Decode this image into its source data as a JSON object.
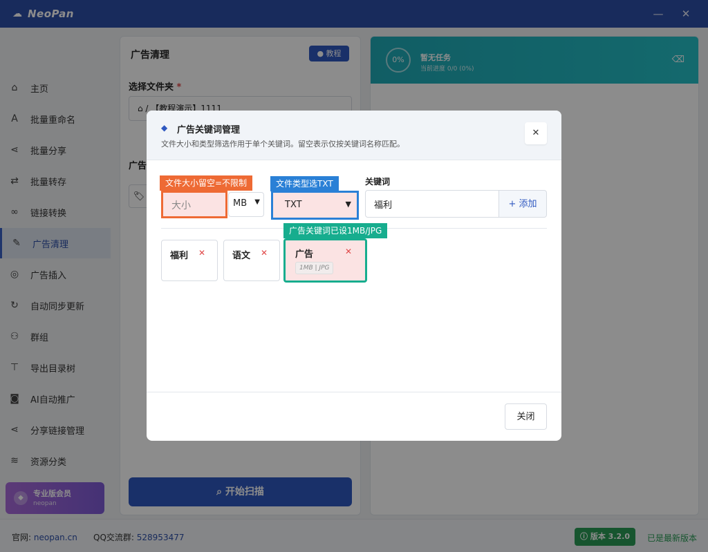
{
  "app": {
    "name": "NeoPan",
    "minimize": "—",
    "close": "✕"
  },
  "sidebar": {
    "items": [
      {
        "label": "主页",
        "icon": "home-icon",
        "glyph": "⌂"
      },
      {
        "label": "批量重命名",
        "icon": "text-icon",
        "glyph": "A"
      },
      {
        "label": "批量分享",
        "icon": "share-icon",
        "glyph": "⋖"
      },
      {
        "label": "批量转存",
        "icon": "transfer-icon",
        "glyph": "⇄"
      },
      {
        "label": "链接转换",
        "icon": "link-icon",
        "glyph": "∞"
      },
      {
        "label": "广告清理",
        "icon": "brush-icon",
        "glyph": "✎"
      },
      {
        "label": "广告插入",
        "icon": "target-icon",
        "glyph": "◎"
      },
      {
        "label": "自动同步更新",
        "icon": "sync-icon",
        "glyph": "↻"
      },
      {
        "label": "群组",
        "icon": "users-icon",
        "glyph": "⚇"
      },
      {
        "label": "导出目录树",
        "icon": "tree-icon",
        "glyph": "⊤"
      },
      {
        "label": "AI自动推广",
        "icon": "robot-icon",
        "glyph": "◙"
      },
      {
        "label": "分享链接管理",
        "icon": "share-icon",
        "glyph": "⋖"
      },
      {
        "label": "资源分类",
        "icon": "layers-icon",
        "glyph": "≋"
      }
    ],
    "vip": {
      "title": "专业版会员",
      "sub": "neopan"
    }
  },
  "left_panel": {
    "title": "广告清理",
    "tutorial": "教程",
    "folder_label": "选择文件夹",
    "required_mark": "*",
    "path": "⌂ / 【教程演示】1111",
    "ad_label": "广告",
    "scan": "开始扫描"
  },
  "right_panel": {
    "progress": "0%",
    "task_title": "暂无任务",
    "task_sub": "当前进度 0/0 (0%)"
  },
  "modal": {
    "title": "广告关键词管理",
    "desc": "文件大小和类型筛选作用于单个关键词。留空表示仅按关键词名称匹配。",
    "annotations": {
      "size": "文件大小留空=不限制",
      "type": "文件类型选TXT",
      "keyword": "广告关键词已设1MB/JPG"
    },
    "size_placeholder": "大小",
    "unit": "MB",
    "type_value": "TXT",
    "keyword_label": "关键词",
    "keyword_value": "福利",
    "add": "+ 添加",
    "keywords": [
      {
        "name": "福利",
        "meta": ""
      },
      {
        "name": "语文",
        "meta": ""
      },
      {
        "name": "广告",
        "meta": "1MB | JPG"
      }
    ],
    "close": "关闭"
  },
  "footer": {
    "site_label": "官网:",
    "site": "neopan.cn",
    "qq_label": "QQ交流群:",
    "qq": "528953477",
    "version": "版本 3.2.0",
    "latest": "已是最新版本"
  }
}
